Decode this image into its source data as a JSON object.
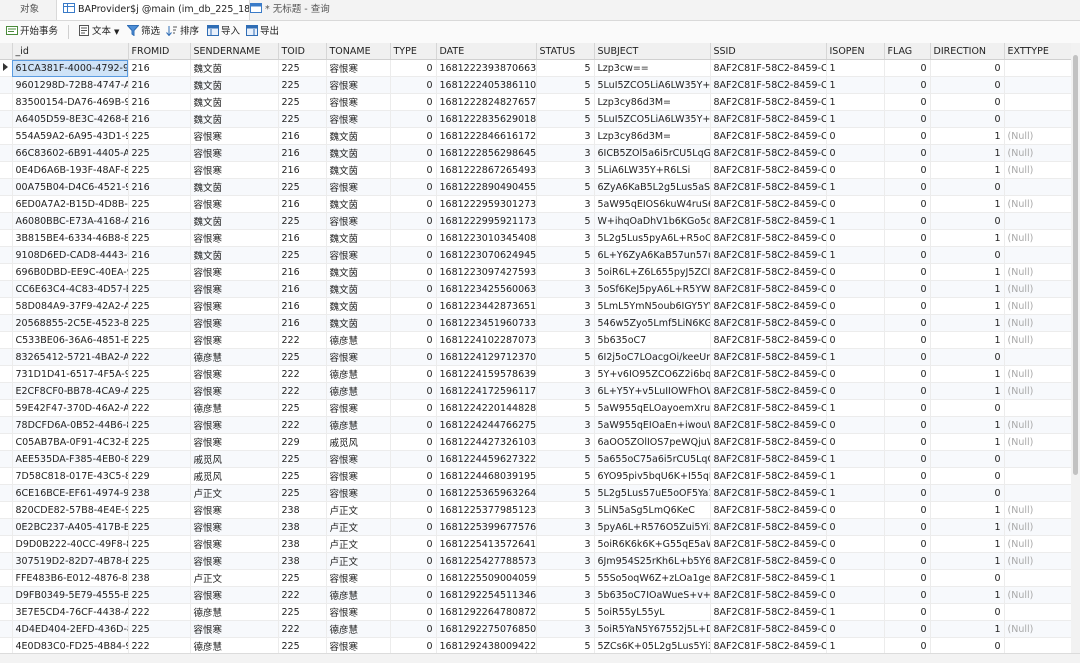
{
  "tabs": [
    {
      "label": "对象"
    },
    {
      "label": "BAProvider$j @main (im_db_225_18..."
    },
    {
      "label": "* 无标题 - 查询"
    }
  ],
  "toolbar": {
    "begin_tx": "开始事务",
    "text": "文本",
    "filter": "筛选",
    "sort": "排序",
    "import": "导入",
    "export": "导出"
  },
  "columns": [
    "_id",
    "FROMID",
    "SENDERNAME",
    "TOID",
    "TONAME",
    "TYPE",
    "DATE",
    "STATUS",
    "SUBJECT",
    "SSID",
    "ISOPEN",
    "FLAG",
    "DIRECTION",
    "EXTTYPE"
  ],
  "rows": [
    [
      "61CA381F-4000-4792-9AE",
      "216",
      "魏文茵",
      "225",
      "容恨寒",
      "0",
      "1681222393870663",
      "5",
      "Lzp3cw==",
      "8AF2C81F-58C2-8459-C45",
      "1",
      "0",
      "0",
      ""
    ],
    [
      "9601298D-72B8-4747-A9(",
      "216",
      "魏文茵",
      "225",
      "容恨寒",
      "0",
      "1681222405386110",
      "5",
      "5LuI5ZCO5LiA6LW35Y+R6",
      "8AF2C81F-58C2-8459-C45",
      "1",
      "0",
      "0",
      ""
    ],
    [
      "83500154-DA76-469B-99",
      "216",
      "魏文茵",
      "225",
      "容恨寒",
      "0",
      "1681222824827657",
      "5",
      "Lzp3cy86d3M=",
      "8AF2C81F-58C2-8459-C45",
      "1",
      "0",
      "0",
      ""
    ],
    [
      "A6405D59-8E3C-4268-BC",
      "216",
      "魏文茵",
      "225",
      "容恨寒",
      "0",
      "1681222835629018",
      "5",
      "5LuI5ZCO5LiA6LW35Y+R6",
      "8AF2C81F-58C2-8459-C45",
      "1",
      "0",
      "0",
      ""
    ],
    [
      "554A59A2-6A95-43D1-90",
      "225",
      "容恨寒",
      "216",
      "魏文茵",
      "0",
      "1681222846616172",
      "3",
      "Lzp3cy86d3M=",
      "8AF2C81F-58C2-8459-C45",
      "0",
      "0",
      "1",
      "(Null)"
    ],
    [
      "66C83602-6B91-4405-A05",
      "225",
      "容恨寒",
      "216",
      "魏文茵",
      "0",
      "1681222856298645",
      "3",
      "6ICB5ZOl5a6i5rCU5LqG",
      "8AF2C81F-58C2-8459-C45",
      "0",
      "0",
      "1",
      "(Null)"
    ],
    [
      "0E4D6A6B-193F-48AF-8A",
      "225",
      "容恨寒",
      "216",
      "魏文茵",
      "0",
      "1681222867265493",
      "3",
      "5LiA6LW35Y+R6LSi",
      "8AF2C81F-58C2-8459-C45",
      "0",
      "0",
      "1",
      "(Null)"
    ],
    [
      "00A75B04-D4C6-4521-99",
      "216",
      "魏文茵",
      "225",
      "容恨寒",
      "0",
      "1681222890490455",
      "5",
      "6ZyA6KaB5L2g5Lus5aSn5",
      "8AF2C81F-58C2-8459-C45",
      "1",
      "0",
      "0",
      ""
    ],
    [
      "6ED0A7A2-B15D-4D8B-B",
      "225",
      "容恨寒",
      "216",
      "魏文茵",
      "0",
      "1681222959301273",
      "3",
      "5aW95qEIOS6kuW4ruS6",
      "8AF2C81F-58C2-8459-C45",
      "0",
      "0",
      "1",
      "(Null)"
    ],
    [
      "A6080BBC-E73A-4168-A8",
      "216",
      "魏文茵",
      "225",
      "容恨寒",
      "0",
      "1681222995921173",
      "5",
      "W+ihqOaDhV1b6KGo5oC",
      "8AF2C81F-58C2-8459-C45",
      "1",
      "0",
      "0",
      ""
    ],
    [
      "3B815BE4-6334-46B8-81",
      "225",
      "容恨寒",
      "216",
      "魏文茵",
      "0",
      "1681223010345408",
      "3",
      "5L2g5Lus5pyA6L+R5oOF5",
      "8AF2C81F-58C2-8459-C45",
      "0",
      "0",
      "1",
      "(Null)"
    ],
    [
      "9108D6ED-CAD8-4443-93",
      "216",
      "魏文茵",
      "225",
      "容恨寒",
      "0",
      "1681223070624945",
      "5",
      "6L+Y6ZyA6KaB57un57ut5",
      "8AF2C81F-58C2-8459-C45",
      "1",
      "0",
      "0",
      ""
    ],
    [
      "696B0DBD-EE9C-40EA-9E",
      "225",
      "容恨寒",
      "216",
      "魏文茵",
      "0",
      "1681223097427593",
      "3",
      "5oiR6L+Z6L655pyJ5ZCI6Y",
      "8AF2C81F-58C2-8459-C45",
      "0",
      "0",
      "1",
      "(Null)"
    ],
    [
      "CC6E63C4-4C83-4D57-B5",
      "225",
      "容恨寒",
      "216",
      "魏文茵",
      "0",
      "1681223425560063",
      "3",
      "5oSf6KeJ5pyA6L+R5YW8(",
      "8AF2C81F-58C2-8459-C45",
      "0",
      "0",
      "1",
      "(Null)"
    ],
    [
      "58D084A9-37F9-42A2-AC",
      "225",
      "容恨寒",
      "216",
      "魏文茵",
      "0",
      "1681223442873651",
      "3",
      "5LmL5YmN5oub6IGY5YW",
      "8AF2C81F-58C2-8459-C45",
      "0",
      "0",
      "1",
      "(Null)"
    ],
    [
      "20568855-2C5E-4523-80A",
      "225",
      "容恨寒",
      "216",
      "魏文茵",
      "0",
      "1681223451960733",
      "3",
      "546w5Zyo5Lmf5LiN6KGM",
      "8AF2C81F-58C2-8459-C45",
      "0",
      "0",
      "1",
      "(Null)"
    ],
    [
      "C533BE06-36A6-4851-BAI",
      "225",
      "容恨寒",
      "222",
      "德彦慧",
      "0",
      "1681224102287073",
      "3",
      "5b635oC7",
      "8AF2C81F-58C2-8459-C45",
      "0",
      "0",
      "1",
      "(Null)"
    ],
    [
      "83265412-5721-4BA2-AD",
      "222",
      "德彦慧",
      "225",
      "容恨寒",
      "0",
      "1681224129712370",
      "5",
      "6I2j5oC7LOacgOi/keeUn+",
      "8AF2C81F-58C2-8459-C45",
      "1",
      "0",
      "0",
      ""
    ],
    [
      "731D1D41-6517-4F5A-99(",
      "225",
      "容恨寒",
      "222",
      "德彦慧",
      "0",
      "1681224159578639",
      "3",
      "5Y+v6IO95ZCO6Z2i6bq75",
      "8AF2C81F-58C2-8459-C45",
      "0",
      "0",
      "1",
      "(Null)"
    ],
    [
      "E2CF8CF0-BB78-4CA9-A5",
      "225",
      "容恨寒",
      "222",
      "德彦慧",
      "0",
      "1681224172596117",
      "3",
      "6L+Y5Y+v5LuIIOWFhOW8",
      "8AF2C81F-58C2-8459-C45",
      "0",
      "0",
      "1",
      "(Null)"
    ],
    [
      "59E42F47-370D-46A2-AEE",
      "222",
      "德彦慧",
      "225",
      "容恨寒",
      "0",
      "1681224220144828",
      "5",
      "5aW955qELOayoemXrum",
      "8AF2C81F-58C2-8459-C45",
      "1",
      "0",
      "0",
      ""
    ],
    [
      "78DCFD6A-0B52-44B6-85",
      "225",
      "容恨寒",
      "222",
      "德彦慧",
      "0",
      "1681224244766275",
      "3",
      "5aW955qEIOaEn+iwouW·",
      "8AF2C81F-58C2-8459-C45",
      "0",
      "0",
      "1",
      "(Null)"
    ],
    [
      "C05AB7BA-0F91-4C32-BE",
      "225",
      "容恨寒",
      "229",
      "戚觅风",
      "0",
      "1681224427326103",
      "3",
      "6aOO5ZOlIOS7peWQjuW",
      "8AF2C81F-58C2-8459-C45",
      "0",
      "0",
      "1",
      "(Null)"
    ],
    [
      "AEE535DA-F385-4EB0-82",
      "229",
      "戚觅风",
      "225",
      "容恨寒",
      "0",
      "1681224459627322",
      "5",
      "5a655oC75a6i5rCU5LqG",
      "8AF2C81F-58C2-8459-C45",
      "1",
      "0",
      "0",
      ""
    ],
    [
      "7D58C818-017E-43C5-82",
      "229",
      "戚觅风",
      "225",
      "容恨寒",
      "0",
      "1681224468039195",
      "5",
      "6YO95piv5bqU6K+I55qE",
      "8AF2C81F-58C2-8459-C45",
      "1",
      "0",
      "0",
      ""
    ],
    [
      "6CE16BCE-EF61-4974-9EC",
      "238",
      "卢正文",
      "225",
      "容恨寒",
      "0",
      "1681225365963264",
      "5",
      "5L2g5Lus57uE5oOF5Ya15",
      "8AF2C81F-58C2-8459-C45",
      "1",
      "0",
      "0",
      ""
    ],
    [
      "820CDE82-57B8-4E4E-98",
      "225",
      "容恨寒",
      "238",
      "卢正文",
      "0",
      "1681225377985123",
      "3",
      "5LiN5aSg5LmQ6KeC",
      "8AF2C81F-58C2-8459-C45",
      "0",
      "0",
      "1",
      "(Null)"
    ],
    [
      "0E2BC237-A405-417B-BA",
      "225",
      "容恨寒",
      "238",
      "卢正文",
      "0",
      "1681225399677576",
      "3",
      "5pyA6L+R576O5Zui5Yi35Y",
      "8AF2C81F-58C2-8459-C45",
      "0",
      "0",
      "1",
      "(Null)"
    ],
    [
      "D9D0B222-40CC-49F8-8B",
      "225",
      "容恨寒",
      "238",
      "卢正文",
      "0",
      "1681225413572641",
      "3",
      "5oiR6K6k6K+G55qE5aWS",
      "8AF2C81F-58C2-8459-C45",
      "0",
      "0",
      "1",
      "(Null)"
    ],
    [
      "307519D2-82D7-4B78-B8",
      "225",
      "容恨寒",
      "238",
      "卢正文",
      "0",
      "1681225427788573",
      "3",
      "6Jm954S25rKh6L+b5Y67I",
      "8AF2C81F-58C2-8459-C45",
      "0",
      "0",
      "1",
      "(Null)"
    ],
    [
      "FFE483B6-E012-4876-852",
      "238",
      "卢正文",
      "225",
      "容恨寒",
      "0",
      "1681225509004059",
      "5",
      "55So5oqW6Z+zLOa1gem",
      "8AF2C81F-58C2-8459-C45",
      "1",
      "0",
      "0",
      ""
    ],
    [
      "D9FB0349-5E79-4555-BDi",
      "225",
      "容恨寒",
      "222",
      "德彦慧",
      "0",
      "1681292254511346",
      "3",
      "5b635oC7IOaWueS+v+W",
      "8AF2C81F-58C2-8459-C45",
      "0",
      "0",
      "1",
      "(Null)"
    ],
    [
      "3E7E5CD4-76CF-4438-A0(",
      "222",
      "德彦慧",
      "225",
      "容恨寒",
      "0",
      "1681292264780872",
      "5",
      "5oiR55yL55yL",
      "8AF2C81F-58C2-8459-C45",
      "1",
      "0",
      "0",
      ""
    ],
    [
      "4D4ED404-2EFD-436D-8E",
      "225",
      "容恨寒",
      "222",
      "德彦慧",
      "0",
      "1681292275076850",
      "3",
      "5oiR5YaN5Y67552j5L+D5",
      "8AF2C81F-58C2-8459-C45",
      "0",
      "0",
      "1",
      "(Null)"
    ],
    [
      "4E0D83C0-FD25-4B84-90(",
      "222",
      "德彦慧",
      "225",
      "容恨寒",
      "0",
      "1681292438009422",
      "5",
      "5ZCs6K+05L2g5Lus5Yi35\\",
      "8AF2C81F-58C2-8459-C45",
      "1",
      "0",
      "0",
      ""
    ]
  ]
}
